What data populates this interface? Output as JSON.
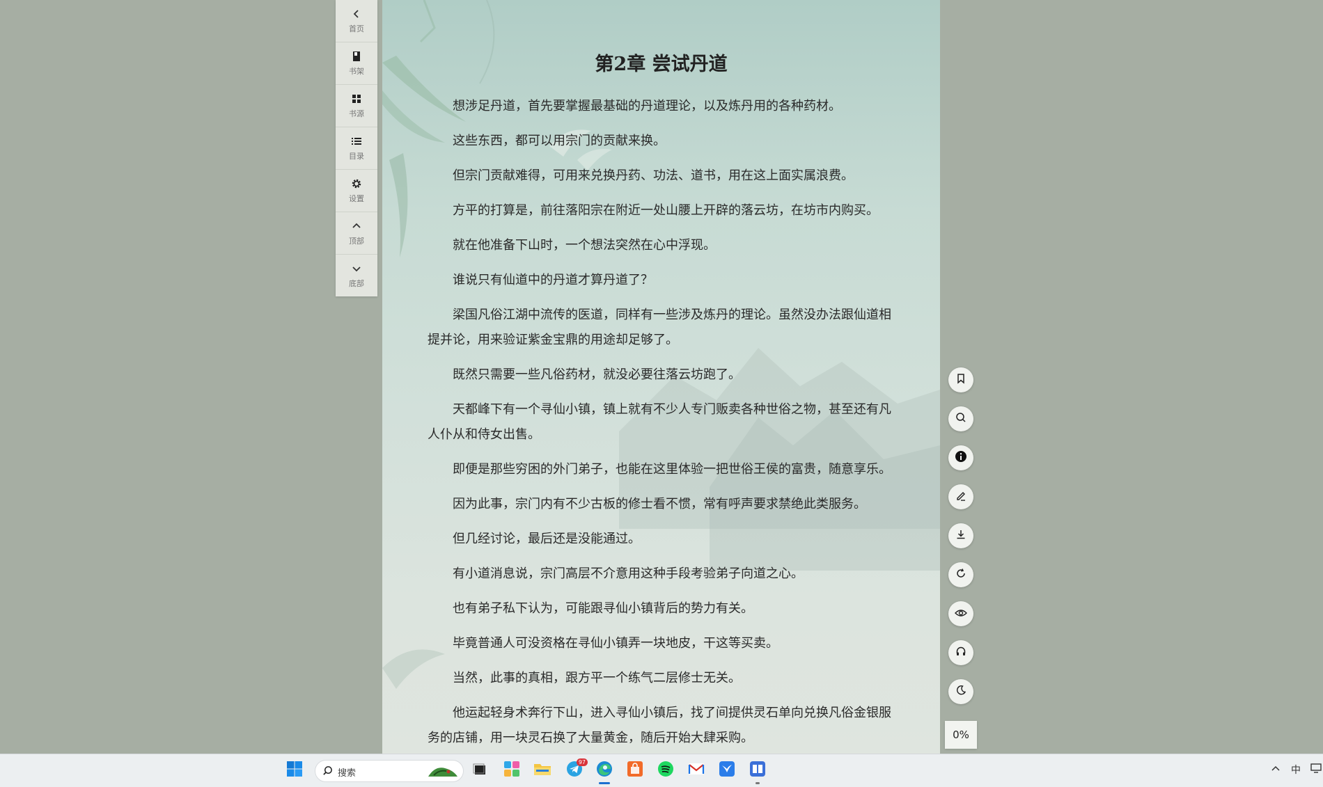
{
  "left_toolbar": {
    "items": [
      {
        "label": "首页",
        "icon": "chevron-left-icon"
      },
      {
        "label": "书架",
        "icon": "book-icon"
      },
      {
        "label": "书源",
        "icon": "grid-icon"
      },
      {
        "label": "目录",
        "icon": "list-icon"
      },
      {
        "label": "设置",
        "icon": "gear-icon"
      },
      {
        "label": "顶部",
        "icon": "chevron-up-icon"
      },
      {
        "label": "底部",
        "icon": "chevron-down-icon"
      }
    ]
  },
  "reader": {
    "chapter_title": "第2章 尝试丹道",
    "paragraphs": [
      "想涉足丹道，首先要掌握最基础的丹道理论，以及炼丹用的各种药材。",
      "这些东西，都可以用宗门的贡献来换。",
      "但宗门贡献难得，可用来兑换丹药、功法、道书，用在这上面实属浪费。",
      "方平的打算是，前往落阳宗在附近一处山腰上开辟的落云坊，在坊市内购买。",
      "就在他准备下山时，一个想法突然在心中浮现。",
      "谁说只有仙道中的丹道才算丹道了？",
      "梁国凡俗江湖中流传的医道，同样有一些涉及炼丹的理论。虽然没办法跟仙道相提并论，用来验证紫金宝鼎的用途却足够了。",
      "既然只需要一些凡俗药材，就没必要往落云坊跑了。",
      "天都峰下有一个寻仙小镇，镇上就有不少人专门贩卖各种世俗之物，甚至还有凡人仆从和侍女出售。",
      "即便是那些穷困的外门弟子，也能在这里体验一把世俗王侯的富贵，随意享乐。",
      "因为此事，宗门内有不少古板的修士看不惯，常有呼声要求禁绝此类服务。",
      "但几经讨论，最后还是没能通过。",
      "有小道消息说，宗门高层不介意用这种手段考验弟子向道之心。",
      "也有弟子私下认为，可能跟寻仙小镇背后的势力有关。",
      "毕竟普通人可没资格在寻仙小镇弄一块地皮，干这等买卖。",
      "当然，此事的真相，跟方平一个练气二层修士无关。",
      "他运起轻身术奔行下山，进入寻仙小镇后，找了间提供灵石单向兑换凡俗金银服务的店铺，用一块灵石换了大量黄金，随后开始大肆采购。"
    ]
  },
  "right_toolbar": {
    "buttons": [
      "bookmark-icon",
      "search-icon",
      "info-icon",
      "edit-icon",
      "download-icon",
      "refresh-icon",
      "eye-icon",
      "headphones-icon",
      "moon-icon"
    ],
    "progress": "0%"
  },
  "taskbar": {
    "search_placeholder": "搜索",
    "telegram_badge": "97",
    "tray_ime": "中"
  }
}
